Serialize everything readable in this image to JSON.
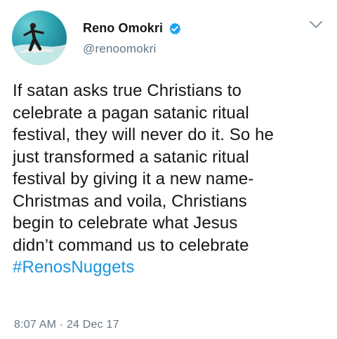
{
  "author": {
    "display_name": "Reno Omokri",
    "handle": "@renoomokri",
    "verified": true
  },
  "tweet": {
    "lines": [
      "If satan asks true Christians to",
      "celebrate a pagan satanic ritual",
      "festival, they will never do it. So he",
      "just transformed a satanic ritual",
      "festival by giving it a new name-",
      "Christmas and voila, Christians",
      "begin to celebrate what Jesus",
      "didn’t command us to celebrate"
    ],
    "hashtag": "#RenosNuggets"
  },
  "meta": {
    "time": "8:07 AM",
    "separator": "·",
    "date": "24 Dec 17"
  },
  "icons": {
    "verified": "verified-badge-icon",
    "menu": "chevron-down-icon"
  },
  "colors": {
    "text": "#14171a",
    "secondary": "#657786",
    "link": "#1b95e0",
    "verified_badge": "#1da1f2"
  }
}
